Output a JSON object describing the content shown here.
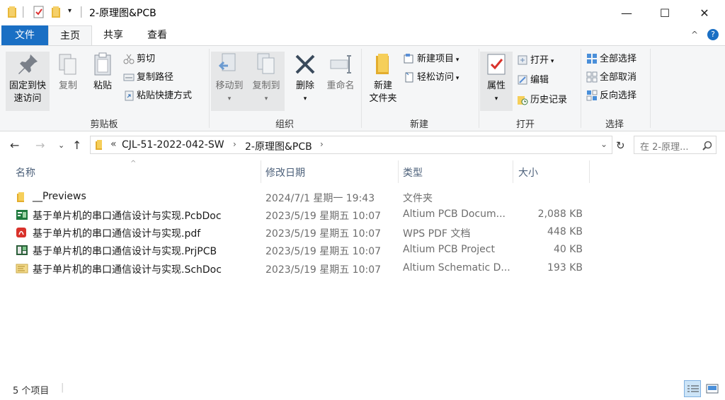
{
  "window": {
    "title": "2-原理图&PCB",
    "controls": {
      "minimize": "—",
      "maximize": "☐",
      "close": "✕"
    }
  },
  "tabs": [
    {
      "label": "文件"
    },
    {
      "label": "主页"
    },
    {
      "label": "共享"
    },
    {
      "label": "查看"
    }
  ],
  "ribbon": {
    "clipboard": {
      "group_label": "剪贴板",
      "pin_line1": "固定到快",
      "pin_line2": "速访问",
      "copy": "复制",
      "paste": "粘贴",
      "cut": "剪切",
      "copy_path": "复制路径",
      "paste_shortcut": "粘贴快捷方式"
    },
    "organize": {
      "group_label": "组织",
      "move_to": "移动到",
      "copy_to": "复制到",
      "delete": "删除",
      "rename": "重命名"
    },
    "new": {
      "group_label": "新建",
      "new_folder_line1": "新建",
      "new_folder_line2": "文件夹",
      "new_item": "新建项目",
      "easy_access": "轻松访问"
    },
    "open": {
      "group_label": "打开",
      "properties": "属性",
      "open": "打开",
      "edit": "编辑",
      "history": "历史记录"
    },
    "select": {
      "group_label": "选择",
      "select_all": "全部选择",
      "select_none": "全部取消",
      "invert": "反向选择"
    }
  },
  "address": {
    "overflow": "«",
    "crumbs": [
      "CJL-51-2022-042-SW",
      "2-原理图&PCB"
    ],
    "search_placeholder": "在 2-原理..."
  },
  "columns": {
    "name": "名称",
    "date": "修改日期",
    "type": "类型",
    "size": "大小"
  },
  "files": [
    {
      "name": "__Previews",
      "date": "2024/7/1 星期一 19:43",
      "type": "文件夹",
      "size": "",
      "icon": "folder-icon"
    },
    {
      "name": "基于单片机的串口通信设计与实现.PcbDoc",
      "date": "2023/5/19 星期五 10:07",
      "type": "Altium PCB Docum...",
      "size": "2,088 KB",
      "icon": "pcbdoc-file-icon"
    },
    {
      "name": "基于单片机的串口通信设计与实现.pdf",
      "date": "2023/5/19 星期五 10:07",
      "type": "WPS PDF 文档",
      "size": "448 KB",
      "icon": "pdf-file-icon"
    },
    {
      "name": "基于单片机的串口通信设计与实现.PrjPCB",
      "date": "2023/5/19 星期五 10:07",
      "type": "Altium PCB Project",
      "size": "40 KB",
      "icon": "prjpcb-file-icon"
    },
    {
      "name": "基于单片机的串口通信设计与实现.SchDoc",
      "date": "2023/5/19 星期五 10:07",
      "type": "Altium Schematic D...",
      "size": "193 KB",
      "icon": "schdoc-file-icon"
    }
  ],
  "status": {
    "count": "5 个项目"
  },
  "colors": {
    "accent": "#1a6fc4",
    "folder": "#f0c04a",
    "pdf": "#d9322b",
    "pcb": "#1f7a3e"
  }
}
